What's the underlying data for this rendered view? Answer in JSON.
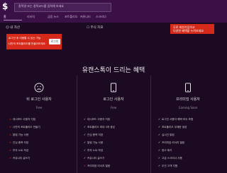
{
  "header": {
    "logo": "$",
    "search_placeholder": "종목명 또는 종목코드를 입력해 보세요",
    "nav": [
      "홈",
      "리서치",
      "금융 뉴스",
      "포트폴리오",
      "커뮤니티",
      "스크리너"
    ]
  },
  "section": {
    "left_label": "☺ 내 자산",
    "middle_label": "☐ 주식 지표",
    "right_alert_line1": "무료 회원가입하고",
    "right_alert_line2": "다양한 혜택을 누려보세요"
  },
  "alert_left": {
    "line1": "로그인 후 이용할 수 있는 기능",
    "line2": "나만의 포트폴리오를 만들어보세요",
    "button": "로그인"
  },
  "benefits": {
    "heading": "유캔스톡이 드리는 혜택",
    "columns": [
      {
        "name": "비 로그인 사용자",
        "status": "Free",
        "features": [
          {
            "ok": false,
            "text": "대시보드 사용자 지정"
          },
          {
            "ok": false,
            "text": "나만의 포트폴리오 만들기"
          },
          {
            "ok": false,
            "text": "알림 기능 사용"
          },
          {
            "ok": false,
            "text": "관심 종목 저장"
          },
          {
            "ok": false,
            "text": "투자 노트 작성"
          },
          {
            "ok": false,
            "text": "커뮤니티 글쓰기"
          }
        ]
      },
      {
        "name": "로그인 사용자",
        "status": "Free",
        "features": [
          {
            "ok": true,
            "text": "대시보드 사용자 지정"
          },
          {
            "ok": true,
            "text": "포트폴리오 최대 3개 생성"
          },
          {
            "ok": true,
            "text": "관심 종목 저장"
          },
          {
            "ok": true,
            "text": "알림 기능 사용"
          },
          {
            "ok": true,
            "text": "투자 노트 작성"
          },
          {
            "ok": true,
            "text": "커뮤니티 글쓰기"
          },
          {
            "ok": false,
            "text": "프리미엄 리서치 열람"
          }
        ]
      },
      {
        "name": "프리미엄 사용자",
        "status": "Coming Soon",
        "features": [
          {
            "ok": true,
            "text": "로그인 사용자 혜택 모두 포함"
          },
          {
            "ok": true,
            "text": "포트폴리오 무제한 생성"
          },
          {
            "ok": true,
            "text": "실시간 알림"
          },
          {
            "ok": true,
            "text": "프리미엄 리서치 열람"
          },
          {
            "ok": true,
            "text": "광고 제거"
          },
          {
            "ok": true,
            "text": "고급 스크리너 사용"
          },
          {
            "ok": true,
            "text": "우선 고객 지원"
          }
        ]
      }
    ]
  },
  "colors": {
    "accent_red": "#d52a1a",
    "topbar": "#3a1046",
    "background": "#1c0a22"
  }
}
